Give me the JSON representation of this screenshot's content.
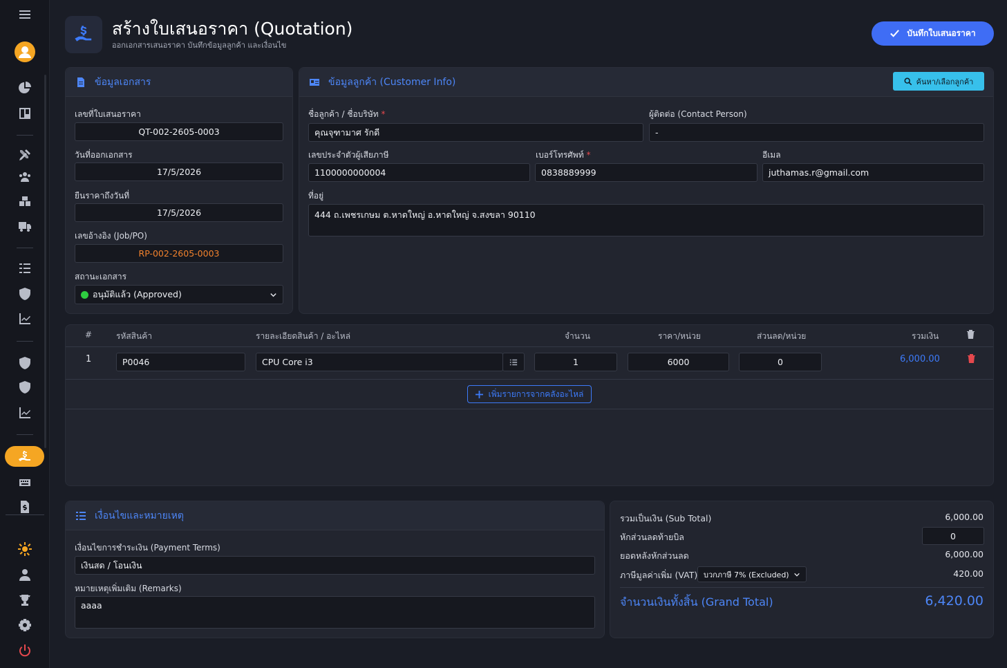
{
  "header": {
    "title": "สร้างใบเสนอราคา (Quotation)",
    "subtitle": "ออกเอกสารเสนอราคา บันทึกข้อมูลลูกค้า และเงื่อนไข",
    "save_label": "บันทึกใบเสนอราคา"
  },
  "doc": {
    "title": "ข้อมูลเอกสาร",
    "quote_no_label": "เลขที่ใบเสนอราคา",
    "quote_no": "QT-002-2605-0003",
    "issue_date_label": "วันที่ออกเอกสาร",
    "issue_date": "17/5/2026",
    "valid_until_label": "ยืนราคาถึงวันที่",
    "valid_until": "17/5/2026",
    "ref_label": "เลขอ้างอิง (Job/PO)",
    "ref_no": "RP-002-2605-0003",
    "status_label": "สถานะเอกสาร",
    "status": "อนุมัติแล้ว (Approved)",
    "status_color": "#2ecc40"
  },
  "customer": {
    "title": "ข้อมูลลูกค้า (Customer Info)",
    "search_label": "ค้นหา/เลือกลูกค้า",
    "name_label": "ชื่อลูกค้า / ชื่อบริษัท",
    "name": "คุณจุฑามาศ รักดี",
    "contact_label": "ผู้ติดต่อ (Contact Person)",
    "contact": "-",
    "tax_label": "เลขประจำตัวผู้เสียภาษี",
    "tax_id": "1100000000004",
    "phone_label": "เบอร์โทรศัพท์",
    "phone": "0838889999",
    "email_label": "อีเมล",
    "email": "juthamas.r@gmail.com",
    "address_label": "ที่อยู่",
    "address": "444 ถ.เพชรเกษม ต.หาดใหญ่ อ.หาดใหญ่ จ.สงขลา 90110",
    "required_mark": "*"
  },
  "items": {
    "headers": [
      "#",
      "รหัสสินค้า",
      "รายละเอียดสินค้า / อะไหล่",
      "จำนวน",
      "ราคา/หน่วย",
      "ส่วนลด/หน่วย",
      "รวมเงิน"
    ],
    "rows": [
      {
        "no": "1",
        "code": "P0046",
        "desc": "CPU Core i3",
        "qty": "1",
        "price": "6000",
        "discount": "0",
        "total": "6,000.00"
      }
    ],
    "add_label": "เพิ่มรายการจากคลังอะไหล่"
  },
  "terms": {
    "title": "เงื่อนไขและหมายเหตุ",
    "payment_label": "เงื่อนไขการชำระเงิน (Payment Terms)",
    "payment": "เงินสด / โอนเงิน",
    "remarks_label": "หมายเหตุเพิ่มเติม (Remarks)",
    "remarks": "aaaa"
  },
  "summary": {
    "subtotal_label": "รวมเป็นเงิน (Sub Total)",
    "subtotal": "6,000.00",
    "bill_discount_label": "หักส่วนลดท้ายบิล",
    "bill_discount": "0",
    "after_discount_label": "ยอดหลังหักส่วนลด",
    "after_discount": "6,000.00",
    "vat_label": "ภาษีมูลค่าเพิ่ม (VAT)",
    "vat_option": "บวกภาษี 7% (Excluded)",
    "vat": "420.00",
    "grand_label": "จำนวนเงินทั้งสิ้น (Grand Total)",
    "grand": "6,420.00"
  }
}
